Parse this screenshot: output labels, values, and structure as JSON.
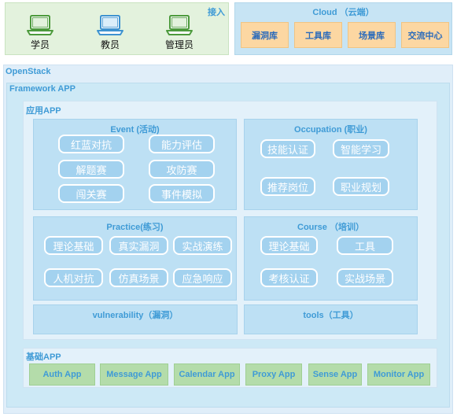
{
  "access": {
    "label": "接入",
    "users": [
      {
        "label": "学员",
        "icon": "laptop-icon",
        "color": "#4c9a3c"
      },
      {
        "label": "教员",
        "icon": "laptop-icon",
        "color": "#3e93d0"
      },
      {
        "label": "管理员",
        "icon": "laptop-icon",
        "color": "#4c9a3c"
      }
    ]
  },
  "cloud": {
    "title": "Cloud （云端）",
    "items": [
      "漏洞库",
      "工具库",
      "场景库",
      "交流中心"
    ]
  },
  "openstack": {
    "title": "OpenStack"
  },
  "framework": {
    "title": "Framework APP"
  },
  "app": {
    "title": "应用APP",
    "event": {
      "title": "Event (活动)",
      "items": [
        "红蓝对抗",
        "能力评估",
        "解题赛",
        "攻防赛",
        "闯关赛",
        "事件模拟"
      ]
    },
    "occupation": {
      "title": "Occupation (职业)",
      "items": [
        "技能认证",
        "智能学习",
        "推荐岗位",
        "职业规划"
      ]
    },
    "practice": {
      "title": "Practice(练习)",
      "items": [
        "理论基础",
        "真实漏洞",
        "实战演练",
        "人机对抗",
        "仿真场景",
        "应急响应"
      ]
    },
    "course": {
      "title": "Course （培训）",
      "items": [
        "理论基础",
        "工具",
        "考核认证",
        "实战场景"
      ]
    },
    "vulnerability": {
      "title": "vulnerability（漏洞）"
    },
    "tools": {
      "title": "tools（工具）"
    }
  },
  "base": {
    "title": "基础APP",
    "items": [
      "Auth App",
      "Message App",
      "Calendar App",
      "Proxy App",
      "Sense App",
      "Monitor App"
    ]
  },
  "colors": {
    "title_blue": "#3f9bd6",
    "access_bg": "#e3f2dd",
    "cloud_bg": "#c7e4f4",
    "orange": "#fcd7a2",
    "pill": "#a3d2ef",
    "green": "#b4dcaa"
  }
}
